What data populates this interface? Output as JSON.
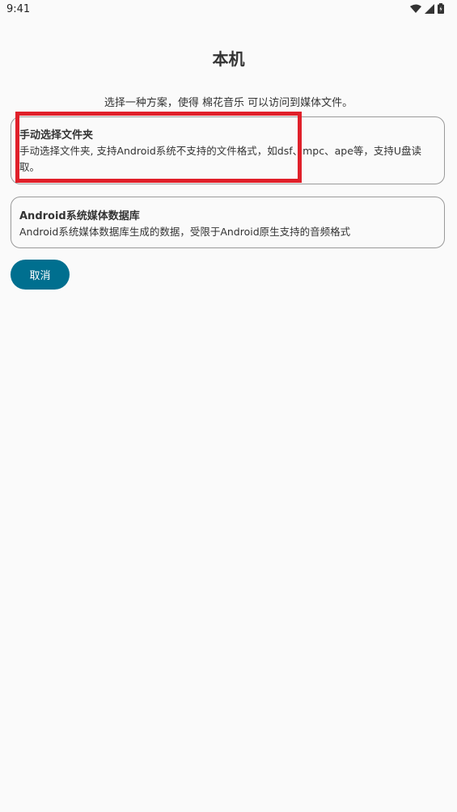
{
  "status_bar": {
    "time": "9:41",
    "icons": [
      "wifi-icon",
      "signal-icon",
      "battery-icon"
    ]
  },
  "page": {
    "title": "本机",
    "subtitle": "选择一种方案，使得 棉花音乐 可以访问到媒体文件。"
  },
  "options": [
    {
      "title": "手动选择文件夹",
      "description": "手动选择文件夹, 支持Android系统不支持的文件格式，如dsf、mpc、ape等，支持U盘读取。"
    },
    {
      "title": "Android系统媒体数据库",
      "description": "Android系统媒体数据库生成的数据，受限于Android原生支持的音频格式"
    }
  ],
  "actions": {
    "cancel_label": "取消"
  },
  "colors": {
    "background": "#fafafa",
    "primary": "#006f8f",
    "highlight": "#e0202a",
    "card_border": "#9a9a9a"
  }
}
